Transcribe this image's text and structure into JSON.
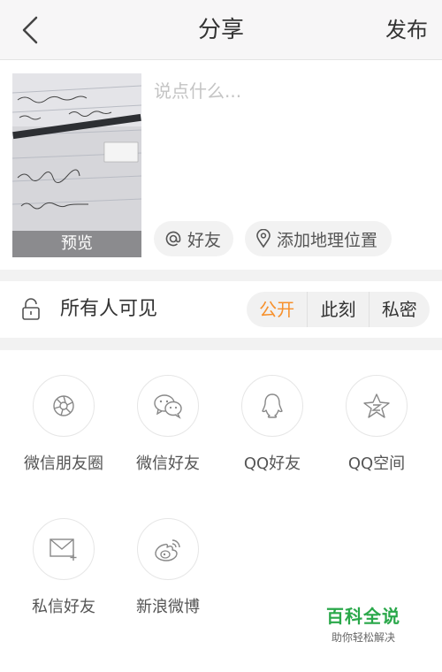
{
  "header": {
    "title": "分享",
    "publish_label": "发布"
  },
  "compose": {
    "placeholder": "说点什么...",
    "photo": {
      "preview_label": "预览"
    },
    "friend_chip": "好友",
    "location_chip": "添加地理位置"
  },
  "visibility": {
    "label": "所有人可见",
    "options": [
      "公开",
      "此刻",
      "私密"
    ],
    "selected": "公开",
    "accent": "#f7902b"
  },
  "share": {
    "items": [
      {
        "label": "微信朋友圈",
        "icon": "wechat-moments-icon"
      },
      {
        "label": "微信好友",
        "icon": "wechat-icon"
      },
      {
        "label": "QQ好友",
        "icon": "qq-icon"
      },
      {
        "label": "QQ空间",
        "icon": "qzone-icon"
      },
      {
        "label": "私信好友",
        "icon": "private-message-icon"
      },
      {
        "label": "新浪微博",
        "icon": "weibo-icon"
      }
    ]
  },
  "watermark": {
    "title": "百科全说",
    "subtitle": "助你轻松解决",
    "color": "#2aa84a"
  }
}
